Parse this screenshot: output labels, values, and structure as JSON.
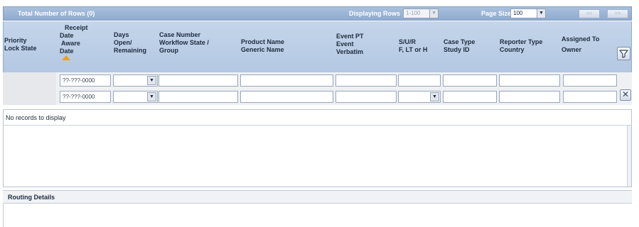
{
  "topbar": {
    "total_rows": "Total Number of Rows (0)",
    "displaying_label": "Displaying Rows",
    "displaying_value": "1-100",
    "page_size_label": "Page Size",
    "page_size_value": "100",
    "prev_label": "<<",
    "next_label": ">>"
  },
  "columns": {
    "c1": [
      "Priority",
      "Lock State"
    ],
    "c2": [
      "Receipt",
      "Date",
      "Aware",
      "Date"
    ],
    "c3": [
      "Days",
      "Open/",
      "Remaining"
    ],
    "c4": [
      "Case Number",
      "Workflow State /",
      "Group"
    ],
    "c5": [
      "Product Name",
      "Generic Name"
    ],
    "c6": [
      "Event PT",
      "Event",
      "Verbatim"
    ],
    "c7": [
      "S/U/R",
      "F, LT or H"
    ],
    "c8": [
      "Case Type",
      "Study ID"
    ],
    "c9": [
      "Reporter Type",
      "Country"
    ],
    "c10": [
      "Assigned To",
      "Owner"
    ]
  },
  "filters": {
    "date_placeholder_1": "??-???-0000",
    "date_placeholder_2": "??-???-0000"
  },
  "grid": {
    "empty_message": "No records to display"
  },
  "routing": {
    "title": "Routing Details"
  },
  "icons": {
    "filter": "filter-icon",
    "clear": "clear-icon",
    "sort": "sort-ascending-icon",
    "dropdown": "chevron-down-icon"
  }
}
